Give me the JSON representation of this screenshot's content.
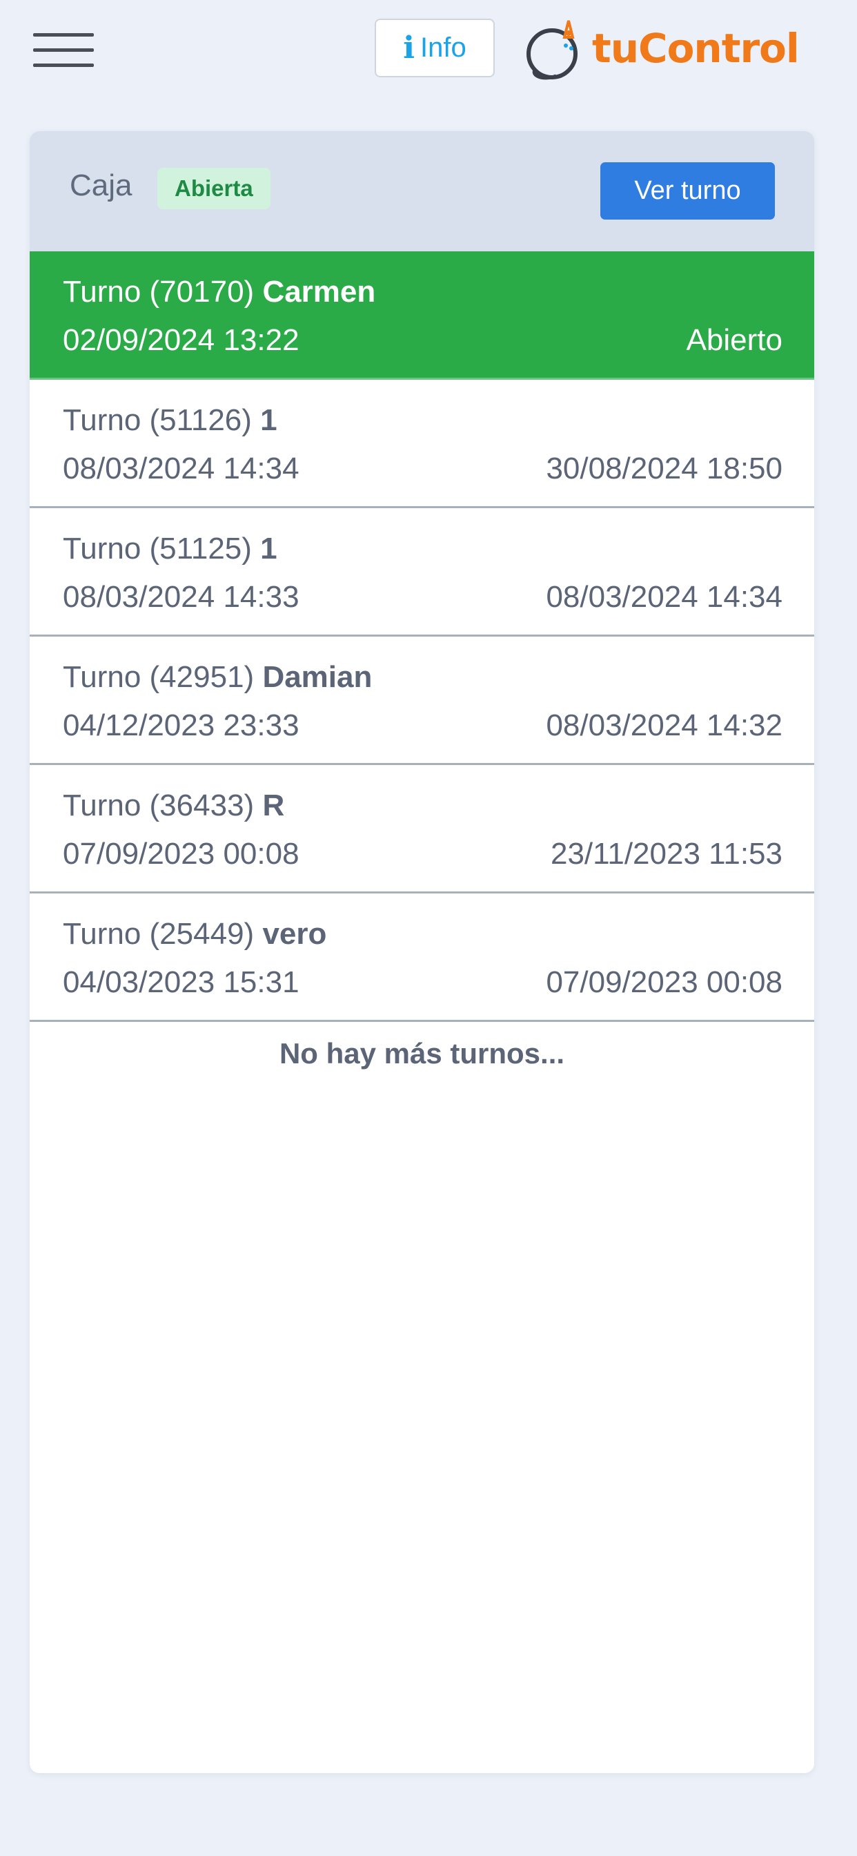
{
  "header": {
    "info_label": "Info",
    "logo_text": "tuControl"
  },
  "caja": {
    "label": "Caja",
    "status": "Abierta",
    "view_button": "Ver turno"
  },
  "turnos": [
    {
      "prefix": "Turno (70170)",
      "name": "Carmen",
      "start": "02/09/2024 13:22",
      "end": "Abierto",
      "active": true
    },
    {
      "prefix": "Turno (51126)",
      "name": "1",
      "start": "08/03/2024 14:34",
      "end": "30/08/2024 18:50"
    },
    {
      "prefix": "Turno (51125)",
      "name": "1",
      "start": "08/03/2024 14:33",
      "end": "08/03/2024 14:34"
    },
    {
      "prefix": "Turno (42951)",
      "name": "Damian",
      "start": "04/12/2023 23:33",
      "end": "08/03/2024 14:32"
    },
    {
      "prefix": "Turno (36433)",
      "name": "R",
      "start": "07/09/2023 00:08",
      "end": "23/11/2023 11:53"
    },
    {
      "prefix": "Turno (25449)",
      "name": "vero",
      "start": "04/03/2023 15:31",
      "end": "07/09/2023 00:08"
    }
  ],
  "footer_text": "No hay más turnos...",
  "colors": {
    "accent_blue": "#2f7de1",
    "active_green": "#2aab48",
    "brand_orange": "#f07a1a"
  }
}
